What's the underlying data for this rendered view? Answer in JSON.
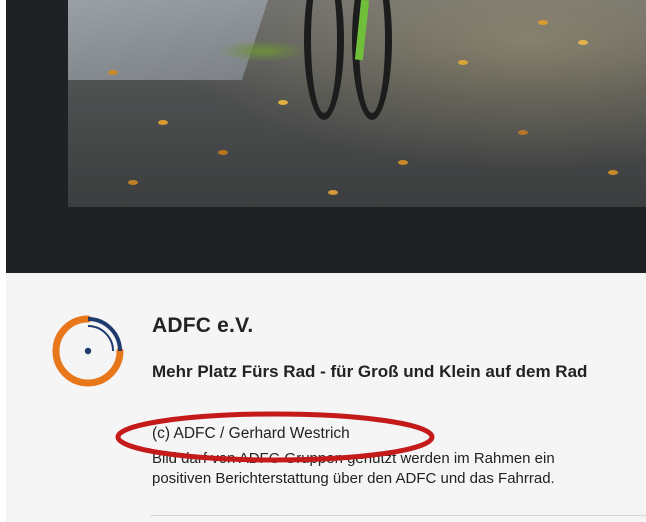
{
  "image": {
    "alt": "Cyclist on autumn leaf-covered road",
    "icon": "photo-bicycle-autumn"
  },
  "card": {
    "org_name": "ADFC e.V.",
    "title": "Mehr Platz Fürs Rad - für Groß und Klein auf dem Rad",
    "credit": "(c) ADFC / Gerhard Westrich",
    "description_line1": "Bild darf von ADFC-Gruppen genutzt werden im Rahmen ein",
    "description_line2": "positiven Berichterstattung über den ADFC und das Fahrrad."
  },
  "logo": {
    "icon": "adfc-logo-icon",
    "orange": "#e8771b",
    "navy": "#1e3a6e"
  },
  "annotation": {
    "shape": "ellipse",
    "color": "#c41a1a"
  },
  "colors": {
    "dark_bg": "#1f2125",
    "caption_bg": "#f5f5f6",
    "text": "#222222"
  }
}
